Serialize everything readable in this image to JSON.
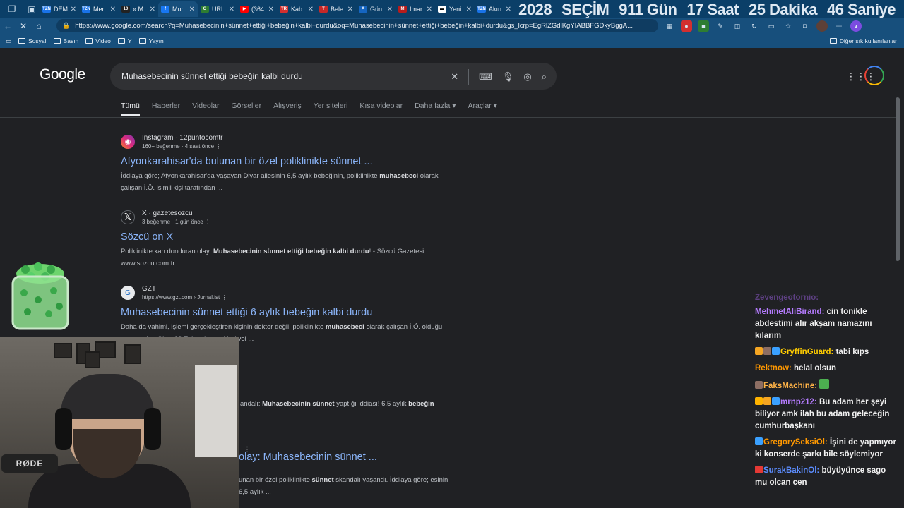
{
  "browser": {
    "tabs": [
      {
        "label": "DEM",
        "fav_text": "TZN",
        "fav_color": "#1a73e8"
      },
      {
        "label": "Meri",
        "fav_text": "TZN",
        "fav_color": "#1a73e8"
      },
      {
        "label": "» M",
        "fav_text": "10",
        "fav_color": "#222222"
      },
      {
        "label": "Muh",
        "fav_text": "f",
        "fav_color": "#1877f2"
      },
      {
        "label": "URL",
        "fav_text": "G",
        "fav_color": "#2e7d32"
      },
      {
        "label": "(364",
        "fav_text": "▶",
        "fav_color": "#ff0000"
      },
      {
        "label": "Kab",
        "fav_text": "TR",
        "fav_color": "#d32f2f"
      },
      {
        "label": "Bele",
        "fav_text": "T",
        "fav_color": "#c62828"
      },
      {
        "label": "Gün",
        "fav_text": "A",
        "fav_color": "#1565c0"
      },
      {
        "label": "İmar",
        "fav_text": "M",
        "fav_color": "#b71c1c"
      },
      {
        "label": "Yeni",
        "fav_text": "▬",
        "fav_color": "#ffffff"
      },
      {
        "label": "Akın",
        "fav_text": "TZN",
        "fav_color": "#1a73e8"
      }
    ],
    "active_tab": 3,
    "url": "https://www.google.com/search?q=Muhasebecinin+sünnet+ettiği+bebeğin+kalbi+durdu&oq=Muhasebecinin+sünnet+ettiği+bebeğin+kalbi+durdu&gs_lcrp=EgRlZGdlKgYIABBFGDkyBggA...",
    "bookmarks": [
      "Sosyal",
      "Basın",
      "Video",
      "Y",
      "Yayın"
    ],
    "bookmarks_right": "Diğer sık kullanılanlar"
  },
  "countdown": [
    "2028",
    "SEÇİM",
    "911 Gün",
    "17 Saat",
    "25 Dakika",
    "46 Saniye"
  ],
  "google": {
    "logo": "Google",
    "query": "Muhasebecinin sünnet ettiği bebeğin kalbi durdu",
    "tabs": [
      "Tümü",
      "Haberler",
      "Videolar",
      "Görseller",
      "Alışveriş",
      "Yer siteleri",
      "Kısa videolar",
      "Daha fazla ▾",
      "Araçlar ▾"
    ],
    "results": [
      {
        "source": "Instagram · 12puntocomtr",
        "meta": "160+ beğenme · 4 saat önce",
        "title": "Afyonkarahisar'da bulunan bir özel poliklinikte sünnet ...",
        "snippet_html": "İddiaya göre; Afyonkarahisar'da yaşayan Diyar ailesinin 6,5 aylık bebeğinin, poliklinikte <b>muhasebeci</b> olarak çalışan İ.Ö. isimli kişi tarafından ..."
      },
      {
        "source": "X · gazetesozcu",
        "meta": "3 beğenme · 1 gün önce",
        "title": "Sözcü on X",
        "snippet_html": "Poliklinikte kan donduran olay: <b>Muhasebecinin sünnet ettiği bebeğin kalbi durdu</b>! - Sözcü Gazetesi. www.sozcu.com.tr."
      },
      {
        "source": "GZT",
        "meta": "https://www.gzt.com › Jurnal.ist",
        "title": "Muhasebecinin sünnet ettiği 6 aylık bebeğin kalbi durdu",
        "snippet_html": "Daha da vahimi, işlemi gerçekleştiren kişinin doktor değil, poliklinikte <b>muhasebeci</b> olarak çalışan İ.Ö. olduğu ortaya çıktı. Olay, 28 Ekim akşamı Yeşilyol ..."
      },
      {
        "partial_snippet_html": "andalı: <b>Muhasebecinin sünnet</b> yaptığı iddiası! 6,5 aylık <b>bebeğin</b>"
      },
      {
        "title_partial": "olay: Muhasebecinin sünnet ...",
        "snippet_html": "unan bir özel poliklinikte <b>sünnet</b> skandalı yaşandı. İddiaya göre; esinin 6,5 aylık ..."
      }
    ]
  },
  "overlay": {
    "mic_text": "RØDE"
  },
  "chat": [
    {
      "user": "Zevengeotornio:",
      "text": "",
      "color": "#9a5fe0",
      "faded": true
    },
    {
      "user": "MehmetAliBirand:",
      "text": "cin tonikle abdestimi alır akşam namazını kılarım",
      "color": "#b57cff"
    },
    {
      "user": "GryffinGuard:",
      "text": "tabi kıps",
      "color": "#ffcc00",
      "badges": [
        "#f5a623",
        "#8d6e63",
        "#3aa0ff"
      ]
    },
    {
      "user": "Rektnow:",
      "text": "helal olsun",
      "color": "#ff9800"
    },
    {
      "user": "FaksMachine:",
      "text": "",
      "color": "#ffb347",
      "badges": [
        "#8d6e63"
      ],
      "emote": "#4caf50"
    },
    {
      "user": "mrnp212:",
      "text": "Bu adam her şeyi biliyor amk ilah bu adam geleceğin cumhurbaşkanı",
      "color": "#b57cff",
      "badges": [
        "#ffb300",
        "#f5a623",
        "#3aa0ff"
      ]
    },
    {
      "user": "GregorySeksiOl:",
      "text": "İşini de yapmıyor ki konserde şarkı bile söylemiyor",
      "color": "#ff9800",
      "badges": [
        "#3aa0ff"
      ]
    },
    {
      "user": "SurakBakinOl:",
      "text": "büyüyünce sago mu olcan cen",
      "color": "#5c8dff",
      "badges": [
        "#e53935"
      ]
    }
  ]
}
